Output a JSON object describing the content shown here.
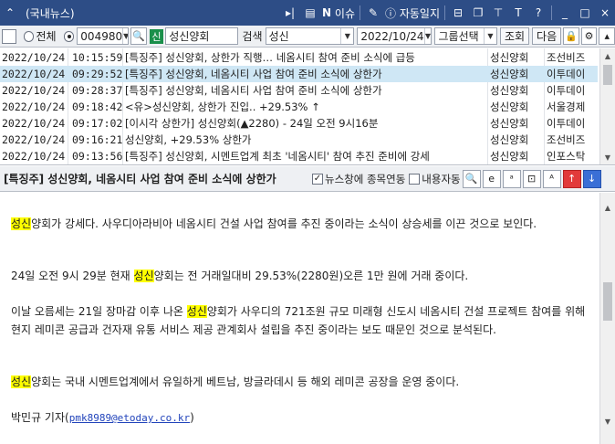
{
  "window": {
    "title": "(국내뉴스)",
    "issue_label": "이슈",
    "autolog_label": "자동일지",
    "controls": [
      "_",
      "□",
      "×"
    ]
  },
  "toolbar": {
    "radio_all_label": "전체",
    "code_value": "004980",
    "stock_badge": "신",
    "stock_name": "성신양회",
    "search_label": "검색",
    "search_value": "성신",
    "date_value": "2022/10/24",
    "group_select": "그룹선택",
    "query_button": "조회",
    "next_button": "다음"
  },
  "news": {
    "rows": [
      {
        "date": "2022/10/24",
        "time": "10:15:59",
        "title": "[특징주] 성신양회, 상한가 직행… 네옴시티 참여 준비 소식에 급등",
        "code": "성신양회",
        "source": "조선비즈"
      },
      {
        "date": "2022/10/24",
        "time": "09:29:52",
        "title": "[특징주] 성신양회, 네옴시티 사업 참여 준비 소식에 상한가",
        "code": "성신양회",
        "source": "이투데이"
      },
      {
        "date": "2022/10/24",
        "time": "09:28:37",
        "title": "[특징주] 성신양회, 네옴시티 사업 참여 준비 소식에 상한가",
        "code": "성신양회",
        "source": "이투데이"
      },
      {
        "date": "2022/10/24",
        "time": "09:18:42",
        "title": "<유>성신양회, 상한가 진입.. +29.53% ↑",
        "code": "성신양회",
        "source": "서울경제"
      },
      {
        "date": "2022/10/24",
        "time": "09:17:02",
        "title": "[이시각 상한가] 성신양회(▲2280) - 24일 오전 9시16분",
        "code": "성신양회",
        "source": "이투데이"
      },
      {
        "date": "2022/10/24",
        "time": "09:16:21",
        "title": "성신양회, +29.53% 상한가",
        "code": "성신양회",
        "source": "조선비즈"
      },
      {
        "date": "2022/10/24",
        "time": "09:13:56",
        "title": "[특징주] 성신양회, 시멘트업계 최초 '네옴시티' 참여 추진 준비에 강세",
        "code": "성신양회",
        "source": "인포스탁"
      }
    ]
  },
  "article": {
    "title": "[특징주] 성신양회, 네옴시티 사업 참여 준비 소식에 상한가",
    "link_news_label": "뉴스창에 종목연동",
    "content_auto_label": "내용자동",
    "p1_hl": "성신",
    "p1_rest": "양회가 강세다. 사우디아라비아 네옴시티 건설 사업 참여를 추진 중이라는 소식이 상승세를 이끈 것으로 보인다.",
    "p2_pre": "24일 오전 9시 29분 현재 ",
    "p2_hl": "성신",
    "p2_rest": "양회는 전 거래일대비 29.53%(2280원)오른 1만 원에 거래 중이다.",
    "p3_pre": "이날 오름세는 21일 장마감 이후 나온 ",
    "p3_hl": "성신",
    "p3_rest": "양회가 사우디의 721조원 규모 미래형 신도시 네옴시티 건설 프로젝트 참여를 위해 현지 레미콘 공급과 건자재 유통 서비스 제공 관계회사 설립을 추진 중이라는 보도 때문인 것으로 분석된다.",
    "p4_hl": "성신",
    "p4_rest": "양회는 국내 시멘트업계에서 유일하게 베트남, 방글라데시 등 해외 레미콘 공장을 운영 중이다.",
    "reporter": "박민규 기자(",
    "email": "pmk8989@etoday.co.kr",
    "reporter_end": ")"
  }
}
